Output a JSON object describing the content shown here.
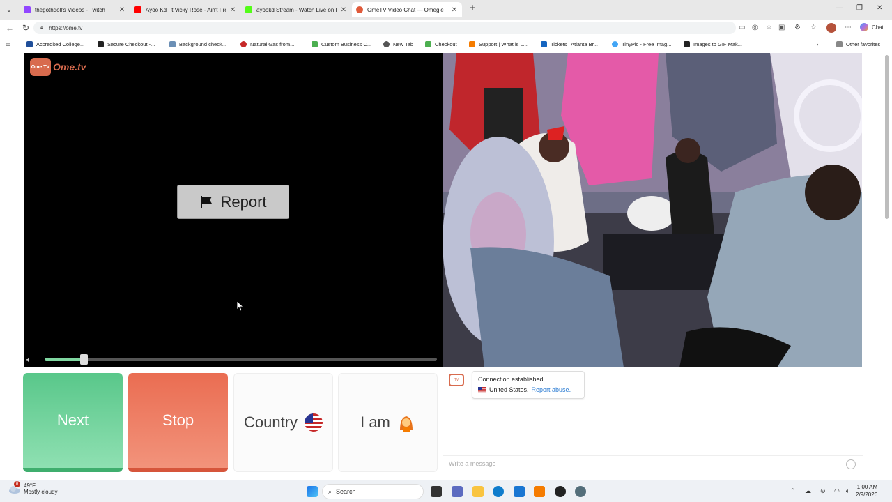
{
  "browser": {
    "tabs": [
      {
        "title": "thegothdoll's Videos - Twitch",
        "favicon_color": "#9146ff",
        "active": false
      },
      {
        "title": "Ayoo Kd Ft Vicky Rose - Ain't Free",
        "favicon_color": "#ff0000",
        "active": false
      },
      {
        "title": "ayookd Stream - Watch Live on Kick",
        "favicon_color": "#53fc18",
        "active": false
      },
      {
        "title": "OmeTV Video Chat — Omegle",
        "favicon_color": "#e05a3a",
        "active": true
      }
    ],
    "url": "https://ome.tv",
    "copilot_label": "Chat",
    "bookmarks": [
      {
        "label": "Accredited College...",
        "color": "#1f4e99"
      },
      {
        "label": "Secure Checkout -...",
        "color": "#222222"
      },
      {
        "label": "Background check...",
        "color": "#6b8fb5"
      },
      {
        "label": "Natural Gas from...",
        "color": "#c62828"
      },
      {
        "label": "Custom Business C...",
        "color": "#4caf50"
      },
      {
        "label": "New Tab",
        "color": "#555555"
      },
      {
        "label": "Checkout",
        "color": "#4caf50"
      },
      {
        "label": "Support | What is L...",
        "color": "#f57c00"
      },
      {
        "label": "Tickets | Atlanta Br...",
        "color": "#1565c0"
      },
      {
        "label": "TinyPic - Free Imag...",
        "color": "#42a5f5"
      },
      {
        "label": "Images to GIF Mak...",
        "color": "#222222"
      }
    ],
    "other_favorites": "Other favorites"
  },
  "page": {
    "logo_text": "Ome.tv",
    "logo_badge": "Ome TV",
    "report_label": "Report",
    "volume_level": 0.1,
    "buttons": {
      "next": "Next",
      "stop": "Stop",
      "country": "Country",
      "iam": "I am"
    },
    "chat": {
      "status": "Connection established.",
      "country": "United States.",
      "report_link": "Report abuse.",
      "input_placeholder": "Write a message"
    }
  },
  "taskbar": {
    "temperature": "49°F",
    "condition": "Mostly cloudy",
    "weather_badge": "8",
    "search_label": "Search",
    "time": "1:00 AM",
    "date": "2/9/2026"
  }
}
